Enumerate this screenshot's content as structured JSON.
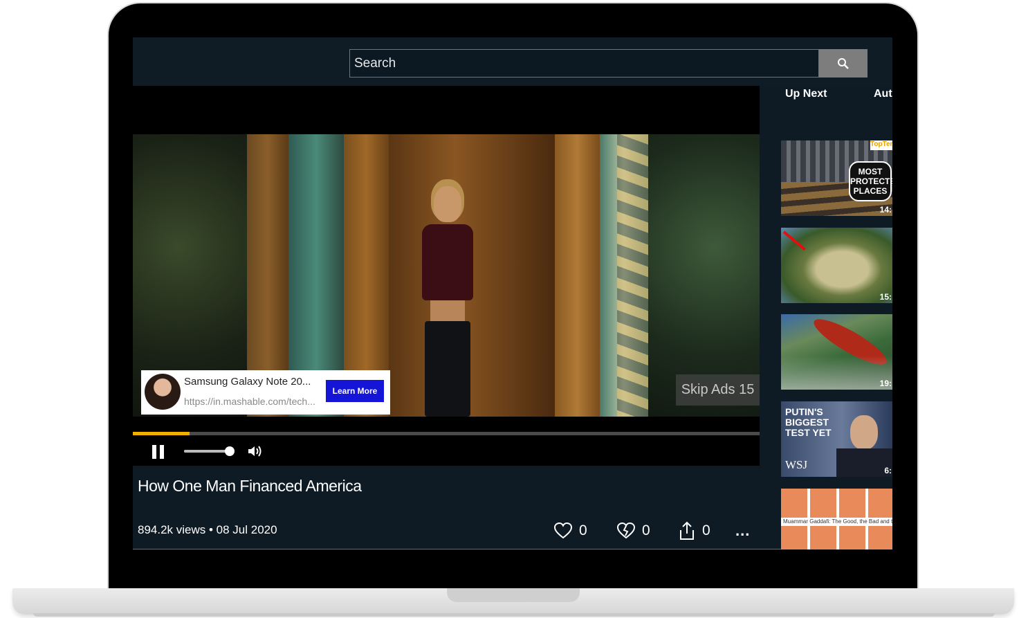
{
  "search": {
    "placeholder": "Search"
  },
  "sidebar": {
    "header": "Up Next",
    "autoplay_label": "Auto"
  },
  "ad": {
    "title": "Samsung Galaxy Note 20...",
    "url": "https://in.mashable.com/tech...",
    "cta": "Learn More"
  },
  "skip": {
    "label": "Skip Ads 15"
  },
  "player": {
    "progress_fraction": 0.09,
    "volume_fraction": 0.95
  },
  "video": {
    "title": "How One Man Financed America",
    "meta": "894.2k views • 08 Jul 2020",
    "likes": "0",
    "dislikes": "0",
    "shares": "0",
    "more": "..."
  },
  "up_next": [
    {
      "overlay": "MOST PROTECTED PLACES",
      "brand": "TopTen",
      "duration": "14:"
    },
    {
      "duration": "15:"
    },
    {
      "duration": "19:"
    },
    {
      "overlay": "PUTIN'S BIGGEST TEST YET",
      "brand": "WSJ",
      "duration": "6:"
    },
    {
      "caption": "Muammar Gaddafi: The Good, the Bad and the"
    }
  ]
}
